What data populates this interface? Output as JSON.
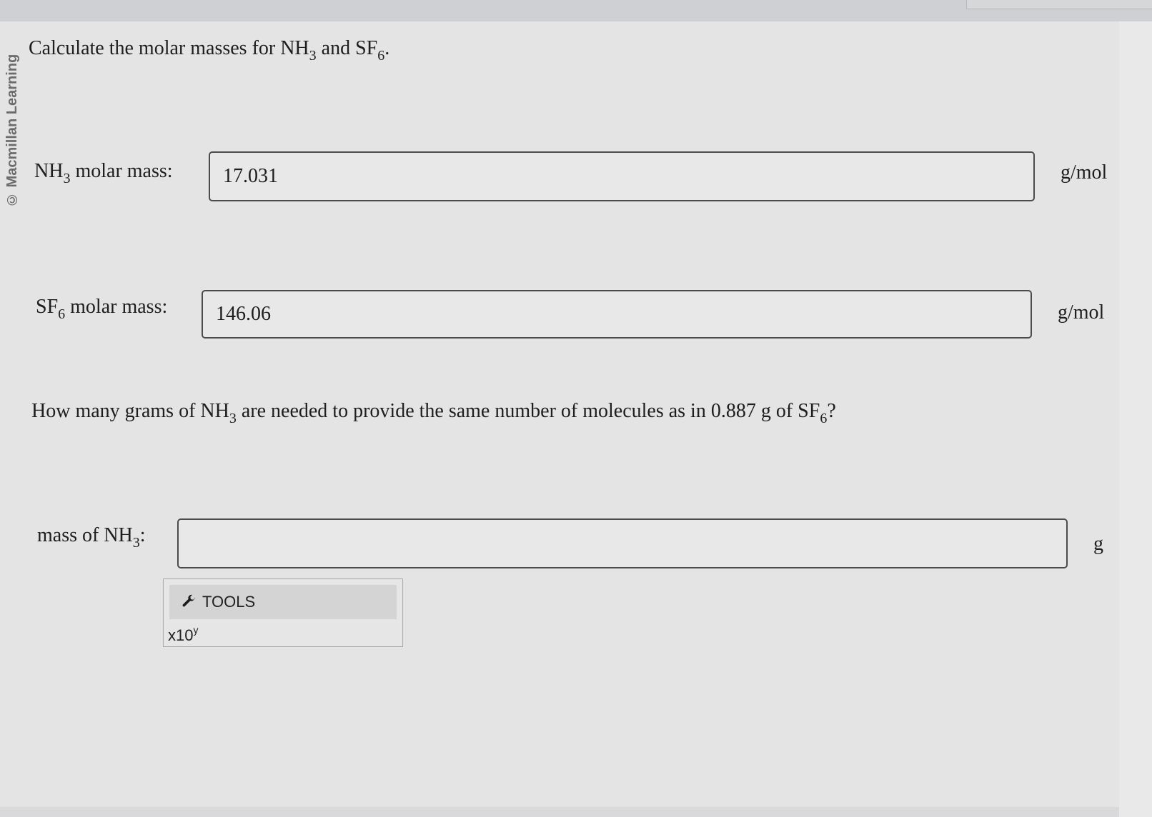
{
  "watermark": "© Macmillan Learning",
  "question": {
    "intro_prefix": "Calculate the molar masses for NH",
    "intro_sub1": "3",
    "intro_mid": " and SF",
    "intro_sub2": "6",
    "intro_suffix": ".",
    "part2_prefix": "How many grams of NH",
    "part2_sub1": "3",
    "part2_mid": " are needed to provide the same number of molecules as in 0.887 g of SF",
    "part2_sub2": "6",
    "part2_suffix": "?"
  },
  "fields": {
    "nh3": {
      "label_prefix": "NH",
      "label_sub": "3",
      "label_suffix": " molar mass:",
      "value": "17.031",
      "unit": "g/mol"
    },
    "sf6": {
      "label_prefix": "SF",
      "label_sub": "6",
      "label_suffix": " molar mass:",
      "value": "146.06",
      "unit": "g/mol"
    },
    "mass": {
      "label_prefix": "mass of NH",
      "label_sub": "3",
      "label_suffix": ":",
      "value": "",
      "unit": "g"
    }
  },
  "tools": {
    "label": "TOOLS",
    "icon": "wrench-icon",
    "sci_base": "x10",
    "sci_exp": "y"
  },
  "colors": {
    "panel": "#e4e4e4",
    "input_border": "#4b4b4b",
    "text": "#1e1e1e"
  }
}
